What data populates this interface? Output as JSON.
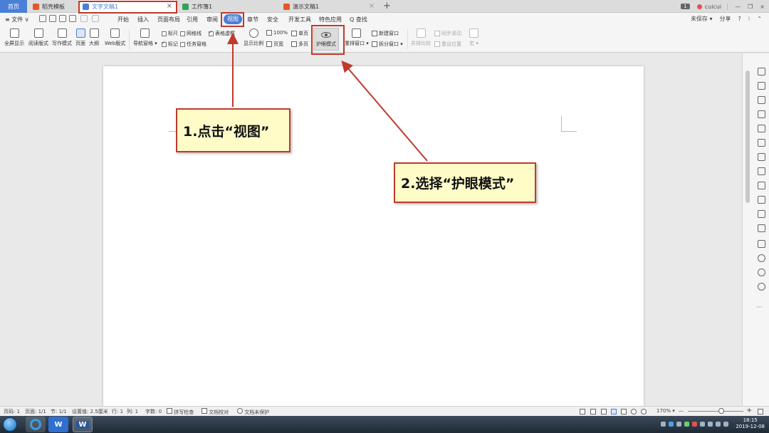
{
  "tabs": {
    "home": "首页",
    "template": "稻壳模板",
    "doc": "文字文稿1",
    "book": "工作簿1",
    "ppt": "演示文稿1",
    "close_glyph": "×",
    "plus_glyph": "+"
  },
  "window_right": {
    "badge": "1",
    "user": "cuicui",
    "minimize": "—",
    "restore": "❐",
    "close": "×"
  },
  "menu": {
    "file": "≡ 文件 ∨",
    "items": [
      "开始",
      "插入",
      "页面布局",
      "引用",
      "审阅",
      "视图",
      "章节",
      "安全",
      "开发工具",
      "特色应用",
      "Q 查找"
    ],
    "right": {
      "unsaved": "未保存 ▾",
      "share": "分享",
      "help": "?",
      "more": "⁝",
      "collapse": "⌃"
    }
  },
  "ribbon": {
    "fullscreen": "全屏显示",
    "reading": "阅读版式",
    "writing": "写作模式",
    "page": "页面",
    "outline": "大纲",
    "web": "Web版式",
    "nav_pane": "导航窗格 ▾",
    "ruler": "标尺",
    "gridlines": "网格线",
    "table_dims": "表格虚框",
    "markup": "标记",
    "task_pane": "任务窗格",
    "zoom": "显示比例",
    "zoom_100": "100%",
    "page_width": "页宽",
    "single_page": "单页",
    "multi_page": "多页",
    "eye_mode": "护眼模式",
    "arrange_windows": "重排窗口 ▾",
    "new_window": "新建窗口",
    "split_window": "拆分窗口 ▾",
    "side_by_side": "并排比较",
    "sync_scroll": "同步滚动",
    "reset_position": "重设位置",
    "macro": "宏 ▾"
  },
  "callouts": {
    "step1": "1.点击“视图”",
    "step2": "2.选择“护眼模式”"
  },
  "status": {
    "page_num": "页码: 1",
    "pages": "页面: 1/1",
    "section": "节: 1/1",
    "set_value": "设置值: 2.5厘米",
    "row": "行: 1",
    "col": "列: 1",
    "words": "字数: 0",
    "spellcheck": "拼写检查",
    "proofread": "文档校对",
    "protection": "文档未保护",
    "zoom_level": "170% ▾",
    "zoom_minus": "—",
    "zoom_plus": "+"
  },
  "taskbar": {
    "time": "18:15",
    "date": "2019-12-08",
    "app_wps": "W",
    "app_word": "W"
  },
  "colors": {
    "accent": "#4a7fd6",
    "highlight_red": "#c0392b",
    "callout_bg": "#fffcc8"
  },
  "icons": {
    "fullscreen": "fullscreen-icon",
    "eye": "eye-icon",
    "search": "search-icon"
  }
}
